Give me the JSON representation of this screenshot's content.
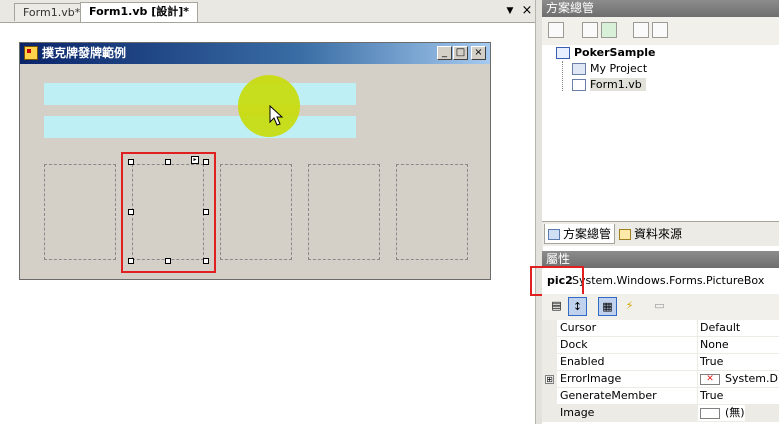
{
  "doc_tabs": [
    "Form1.vb*",
    "Form1.vb [設計]*"
  ],
  "tab_controls": {
    "dropdown": "▼",
    "close": "×"
  },
  "form": {
    "title": "撲克牌發牌範例",
    "caption_buttons": {
      "minimize": "_",
      "maximize": "□",
      "close": "×"
    }
  },
  "solution_explorer": {
    "title": "方案總管",
    "tree": {
      "root": "PokerSample",
      "children": [
        "My Project",
        "Form1.vb"
      ]
    }
  },
  "panel_tabs": [
    "方案總管",
    "資料來源"
  ],
  "properties": {
    "title": "屬性",
    "object_name": "pic2",
    "object_type": "System.Windows.Forms.PictureBox",
    "rows": [
      {
        "name": "Cursor",
        "value": "Default"
      },
      {
        "name": "Dock",
        "value": "None"
      },
      {
        "name": "Enabled",
        "value": "True"
      },
      {
        "name": "ErrorImage",
        "value": "System.Dra",
        "expandable": "⊞"
      },
      {
        "name": "GenerateMember",
        "value": "True"
      },
      {
        "name": "Image",
        "value": "(無)"
      }
    ]
  },
  "colors": {
    "highlight": "#e02020",
    "textbox": "#bdeff5",
    "cursor_halo": "#c8dc00",
    "title_gradient_start": "#0a246a"
  }
}
